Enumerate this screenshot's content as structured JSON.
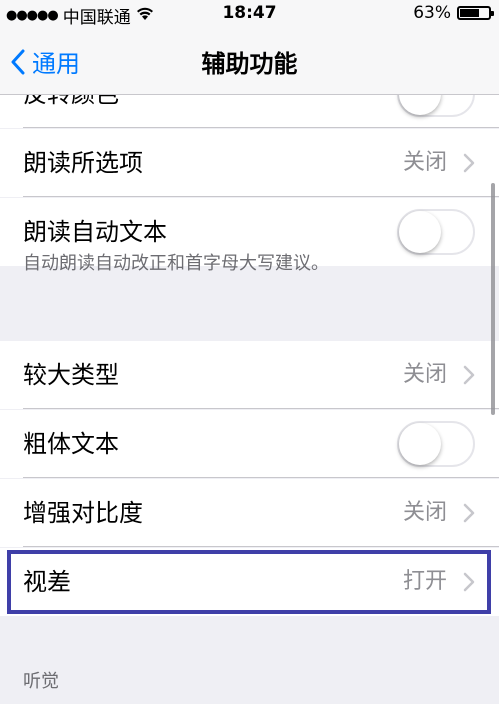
{
  "status_bar": {
    "signal_dots": "●●●●●",
    "carrier": "中国联通",
    "wifi_icon": "wifi-icon",
    "time": "18:47",
    "battery_percent": "63%",
    "battery_level": 0.63
  },
  "nav": {
    "back_label": "通用",
    "title": "辅助功能"
  },
  "rows": [
    {
      "label": "反转颜色",
      "control": "toggle",
      "on": false
    },
    {
      "label": "朗读所选项",
      "value": "关闭"
    },
    {
      "label": "朗读自动文本",
      "control": "toggle",
      "on": false
    },
    {
      "label": "较大类型",
      "value": "关闭"
    },
    {
      "label": "粗体文本",
      "control": "toggle",
      "on": false
    },
    {
      "label": "增强对比度",
      "value": "关闭"
    },
    {
      "label": "视差",
      "value": "打开"
    }
  ],
  "footer_note": "自动朗读自动改正和首字母大写建议。",
  "section_header": "听觉",
  "highlight_color": "#3f3fa8",
  "accent_color": "#007aff"
}
